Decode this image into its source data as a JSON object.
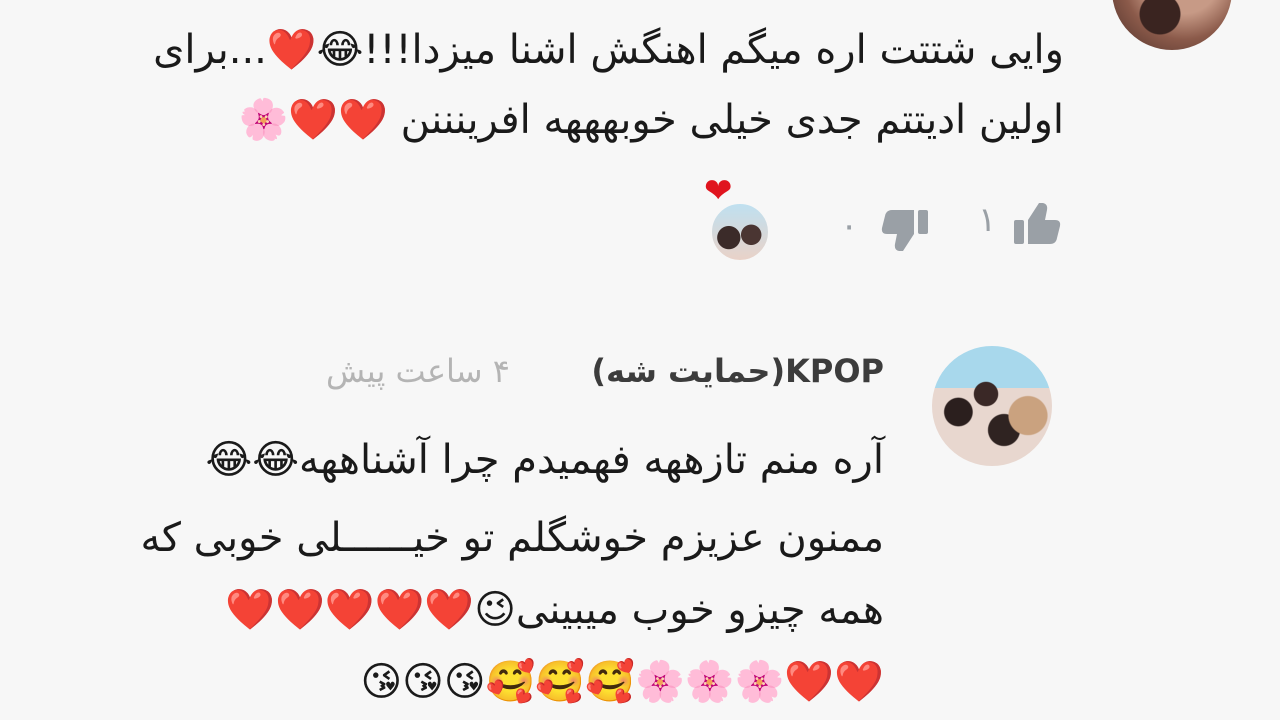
{
  "top_comment": {
    "lines": [
      "وایی شتتت اره میگم اهنگش اشنا میزدا!!!😂❤️...برای",
      "اولین ادیتتم جدی خیلی خوبهههه افرینننن ❤️❤️🌸"
    ],
    "reaction_heart": "❤",
    "like_count": "۱",
    "dislike_count": "۰"
  },
  "reply": {
    "author": "KPOP(حمایت شه)",
    "time": "۴ ساعت پیش",
    "lines": [
      "آره منم تازههه فهمیدم چرا آشناههه😂😂",
      "ممنون عزیزم خوشگلم تو خیــــــلی خوبی که",
      "همه چیزو خوب میبینی😉❤️❤️❤️❤️❤️",
      "❤️❤️🌸🌸🌸🥰🥰🥰😘😘😘"
    ]
  },
  "colors": {
    "background": "#f7f7f7",
    "heart": "#e0141e",
    "icon_gray": "#9aa0a6",
    "muted_text": "#b4b4b4"
  },
  "icons": [
    "like-icon",
    "dislike-icon",
    "heart-reaction-icon"
  ]
}
